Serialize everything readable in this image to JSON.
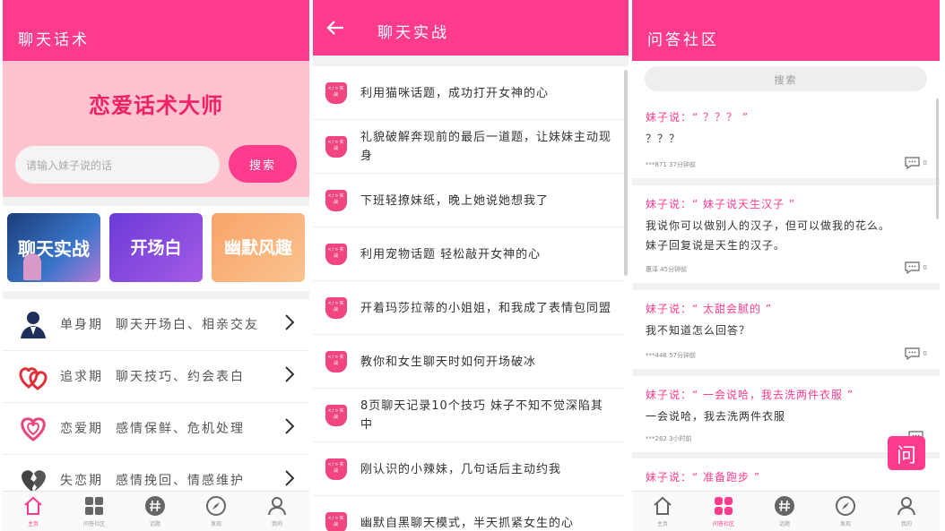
{
  "screen1": {
    "title": "聊天话术",
    "brand": "恋爱话术大师",
    "search_placeholder": "请输入妹子说的话",
    "search_button": "搜索",
    "cards": [
      {
        "label": "聊天实战"
      },
      {
        "label": "开场白"
      },
      {
        "label": "幽默风趣"
      }
    ],
    "stages": [
      {
        "name": "单身期",
        "desc": "聊天开场白、相亲交友",
        "icon": "man-avatar-icon"
      },
      {
        "name": "追求期",
        "desc": "聊天技巧、约会表白",
        "icon": "double-heart-icon"
      },
      {
        "name": "恋爱期",
        "desc": "感情保鲜、危机处理",
        "icon": "heart-outline-icon"
      },
      {
        "name": "失恋期",
        "desc": "感情挽回、情感维护",
        "icon": "broken-heart-icon"
      }
    ]
  },
  "screen2": {
    "title": "聊天实战",
    "badge": "</>实战",
    "items": [
      "利用猫咪话题，成功打开女神的心",
      "礼貌破解奔现前的最后一道题，让妹妹主动现身",
      "下班轻撩妹纸，晚上她说她想我了",
      "利用宠物话题 轻松敲开女神的心",
      "开着玛莎拉蒂的小姐姐，和我成了表情包同盟",
      "教你和女生聊天时如何开场破冰",
      "8页聊天记录10个技巧 妹子不知不觉深陷其中",
      "刚认识的小辣妹，几句话后主动约我",
      "幽默自黑聊天模式，半天抓紧女生的心"
    ]
  },
  "screen3": {
    "title": "问答社区",
    "search_label": "搜索",
    "posts": [
      {
        "title": "妹子说：“ ？？？ ”",
        "body": [
          "？？？"
        ],
        "meta": "***871 37分钟前",
        "comments": "0"
      },
      {
        "title": "妹子说：“ 妹子说天生汉子 ”",
        "body": [
          "我说你可以做别人的汉子，但可以做我的花么。",
          "妹子回复说是天生的汉子。"
        ],
        "meta": "惠泽 45分钟前",
        "comments": "0"
      },
      {
        "title": "妹子说：“ 太甜会腻的 ”",
        "body": [
          "我不知道怎么回答？"
        ],
        "meta": "***448 57分钟前",
        "comments": "0"
      },
      {
        "title": "妹子说：“ 一会说哈，我去洗两件衣服 ”",
        "body": [
          "一会说哈，我去洗两件衣服"
        ],
        "meta": "***262 3小时前",
        "comments": ""
      },
      {
        "title": "妹子说：“ 准备跑步 ”",
        "body": [],
        "meta": "",
        "comments": ""
      }
    ],
    "float_button": "问"
  },
  "tabbar": {
    "tabs": [
      {
        "label": "主页",
        "icon": "home-icon"
      },
      {
        "label": "问答社区",
        "icon": "grid-icon"
      },
      {
        "label": "话题",
        "icon": "hashtag-icon"
      },
      {
        "label": "发现",
        "icon": "compass-icon"
      },
      {
        "label": "我的",
        "icon": "user-icon"
      }
    ],
    "active_screen1": 0,
    "active_screen3": 1
  },
  "colors": {
    "accent": "#fe3b8d",
    "banner": "#ffc3cf"
  }
}
